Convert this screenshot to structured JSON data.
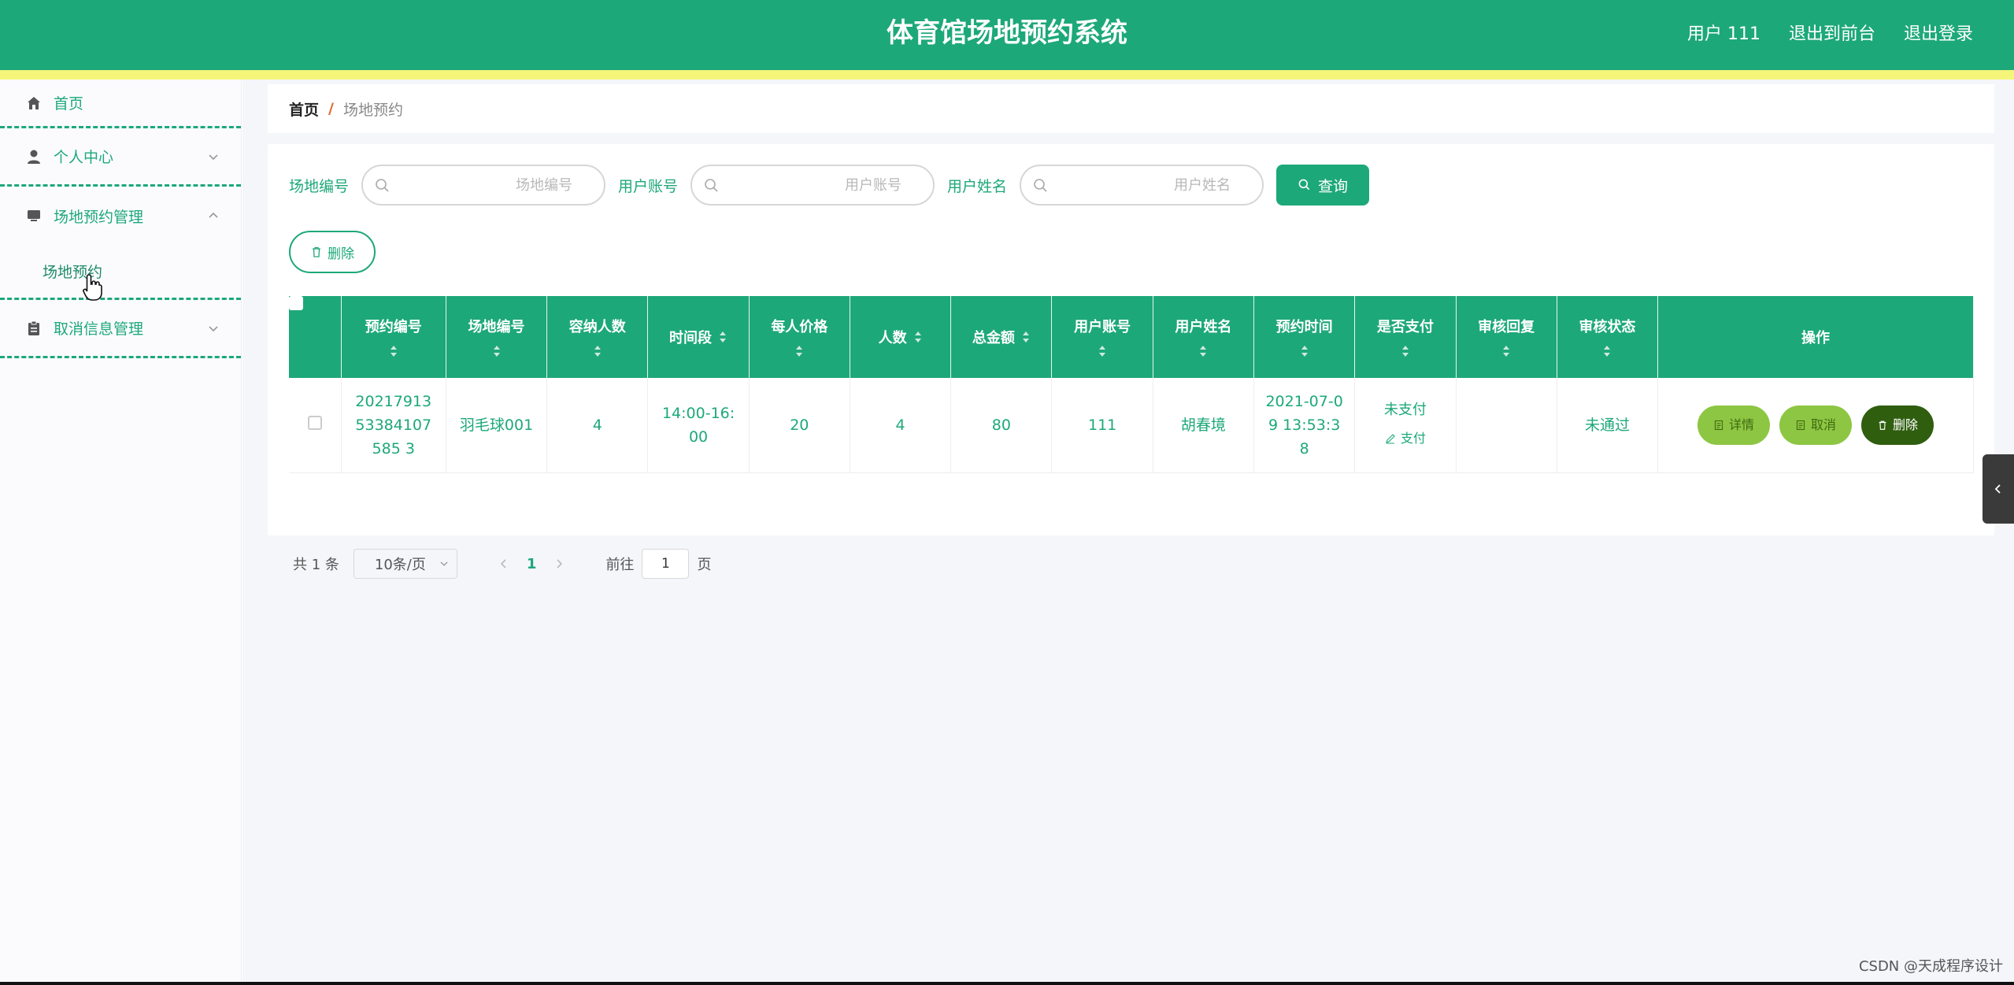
{
  "header": {
    "title": "体育馆场地预约系统",
    "user_label": "用户 111",
    "to_front_label": "退出到前台",
    "logout_label": "退出登录",
    "colors": {
      "primary": "#1da87a",
      "stripe": "#f5f57a"
    }
  },
  "sidebar": {
    "items": [
      {
        "label": "首页",
        "icon": "home-icon"
      },
      {
        "label": "个人中心",
        "icon": "user-icon"
      },
      {
        "label": "场地预约管理",
        "icon": "monitor-icon"
      },
      {
        "label": "取消信息管理",
        "icon": "clipboard-icon"
      }
    ],
    "submenu": {
      "label": "场地预约"
    }
  },
  "breadcrumb": {
    "home": "首页",
    "separator": "/",
    "current": "场地预约"
  },
  "search": {
    "venue_no_label": "场地编号",
    "venue_no_placeholder": "场地编号",
    "account_label": "用户账号",
    "account_placeholder": "用户账号",
    "name_label": "用户姓名",
    "name_placeholder": "用户姓名",
    "query_label": "查询"
  },
  "actions": {
    "batch_delete_label": "删除"
  },
  "table": {
    "headers": [
      "预约编号",
      "场地编号",
      "容纳人数",
      "时间段",
      "每人价格",
      "人数",
      "总金额",
      "用户账号",
      "用户姓名",
      "预约时间",
      "是否支付",
      "审核回复",
      "审核状态",
      "操作"
    ],
    "rows": [
      {
        "booking_no": "2021791353384107585 3",
        "venue_no": "羽毛球001",
        "capacity": "4",
        "time_slot": "14:00-16:00",
        "price": "20",
        "people": "4",
        "total": "80",
        "account": "111",
        "name": "胡春境",
        "booking_time": "2021-07-09 13:53:38",
        "pay_status": "未支付",
        "pay_link": "支付",
        "review_reply": "",
        "review_status": "未通过",
        "detail_label": "详情",
        "cancel_label": "取消",
        "delete_label": "删除"
      }
    ]
  },
  "pagination": {
    "total": "共 1 条",
    "page_size": "10条/页",
    "current_page": "1",
    "goto_prefix": "前往",
    "goto_value": "1",
    "goto_suffix": "页"
  },
  "watermark": "CSDN @天成程序设计"
}
